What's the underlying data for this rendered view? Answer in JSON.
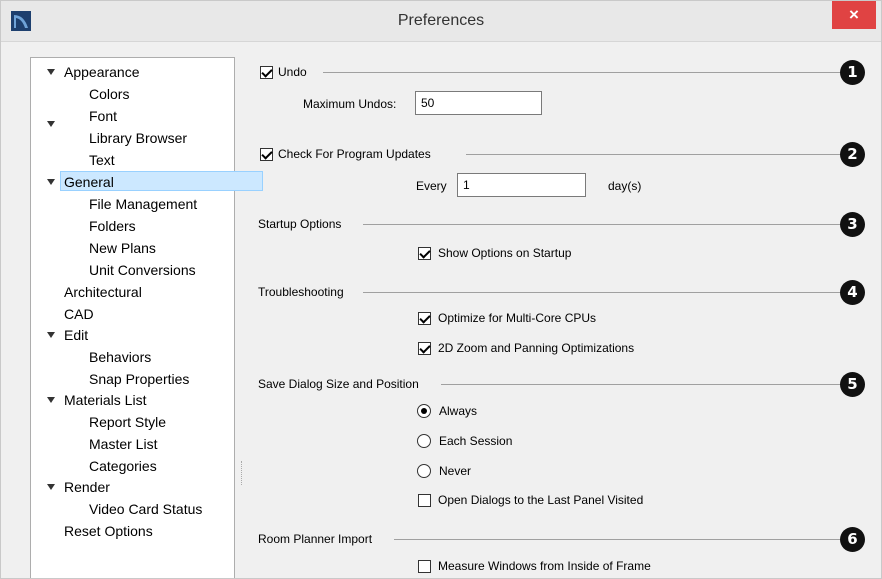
{
  "window": {
    "title": "Preferences",
    "close_symbol": "×",
    "icon": "app-logo-icon"
  },
  "tree": {
    "items": [
      {
        "label": "Appearance",
        "level": 0,
        "expanded": true
      },
      {
        "label": "Colors",
        "level": 1
      },
      {
        "label": "Font",
        "level": 1
      },
      {
        "label": "Library Browser",
        "level": 1
      },
      {
        "label": "Text",
        "level": 1
      },
      {
        "label": "General",
        "level": 0,
        "expanded": true,
        "selected": true
      },
      {
        "label": "File Management",
        "level": 1
      },
      {
        "label": "Folders",
        "level": 1
      },
      {
        "label": "New Plans",
        "level": 1
      },
      {
        "label": "Unit Conversions",
        "level": 1
      },
      {
        "label": "Architectural",
        "level": 0
      },
      {
        "label": "CAD",
        "level": 0
      },
      {
        "label": "Edit",
        "level": 0,
        "expanded": true
      },
      {
        "label": "Behaviors",
        "level": 1
      },
      {
        "label": "Snap Properties",
        "level": 1
      },
      {
        "label": "Materials List",
        "level": 0,
        "expanded": true
      },
      {
        "label": "Report Style",
        "level": 1
      },
      {
        "label": "Master List",
        "level": 1
      },
      {
        "label": "Categories",
        "level": 1
      },
      {
        "label": "Render",
        "level": 0,
        "expanded": true
      },
      {
        "label": "Video Card Status",
        "level": 1
      },
      {
        "label": "Reset Options",
        "level": 0
      }
    ]
  },
  "undo": {
    "label": "Undo",
    "checked": true,
    "max_label": "Maximum Undos:",
    "max_value": "50",
    "badge": "1"
  },
  "updates": {
    "label": "Check For Program Updates",
    "checked": true,
    "every_label": "Every",
    "every_value": "1",
    "unit": "day(s)",
    "badge": "2"
  },
  "startup": {
    "label": "Startup Options",
    "show_options": "Show Options on Startup",
    "show_checked": true,
    "badge": "3"
  },
  "troubleshooting": {
    "label": "Troubleshooting",
    "multicore": "Optimize for Multi-Core CPUs",
    "multicore_checked": true,
    "zoom": "2D Zoom and Panning Optimizations",
    "zoom_checked": true,
    "badge": "4"
  },
  "save_dialog": {
    "label": "Save Dialog Size and Position",
    "options": [
      "Always",
      "Each Session",
      "Never"
    ],
    "selected": "Always",
    "last_panel": "Open Dialogs to the Last Panel Visited",
    "last_panel_checked": false,
    "badge": "5"
  },
  "room_planner": {
    "label": "Room Planner Import",
    "measure": "Measure Windows from Inside of Frame",
    "measure_checked": false,
    "badge": "6"
  },
  "colors": {
    "selection": "#cce8ff",
    "close_button": "#e04343",
    "badge": "#111111"
  }
}
